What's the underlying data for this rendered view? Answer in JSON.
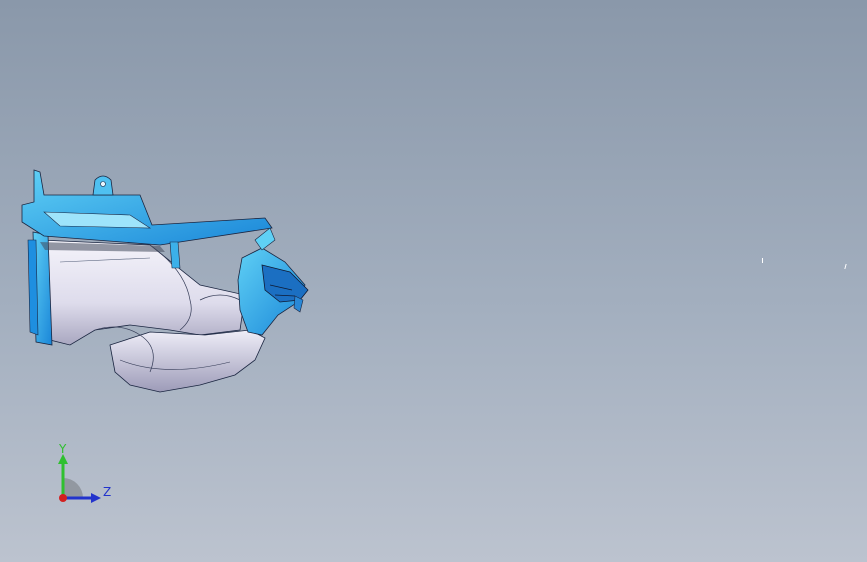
{
  "viewport": {
    "background_top": "#8a98aa",
    "background_bottom": "#bcc3cf"
  },
  "model": {
    "part_colors": {
      "duct_body": "#e8e6f2",
      "duct_shadow": "#b8b6cc",
      "bracket_blue": "#1e8fe0",
      "bracket_light": "#4fc0f0",
      "edge": "#1a2540"
    }
  },
  "triad": {
    "y_label": "Y",
    "z_label": "Z",
    "y_color": "#2fc02f",
    "z_color": "#2233cc",
    "origin_color": "#d22020"
  }
}
